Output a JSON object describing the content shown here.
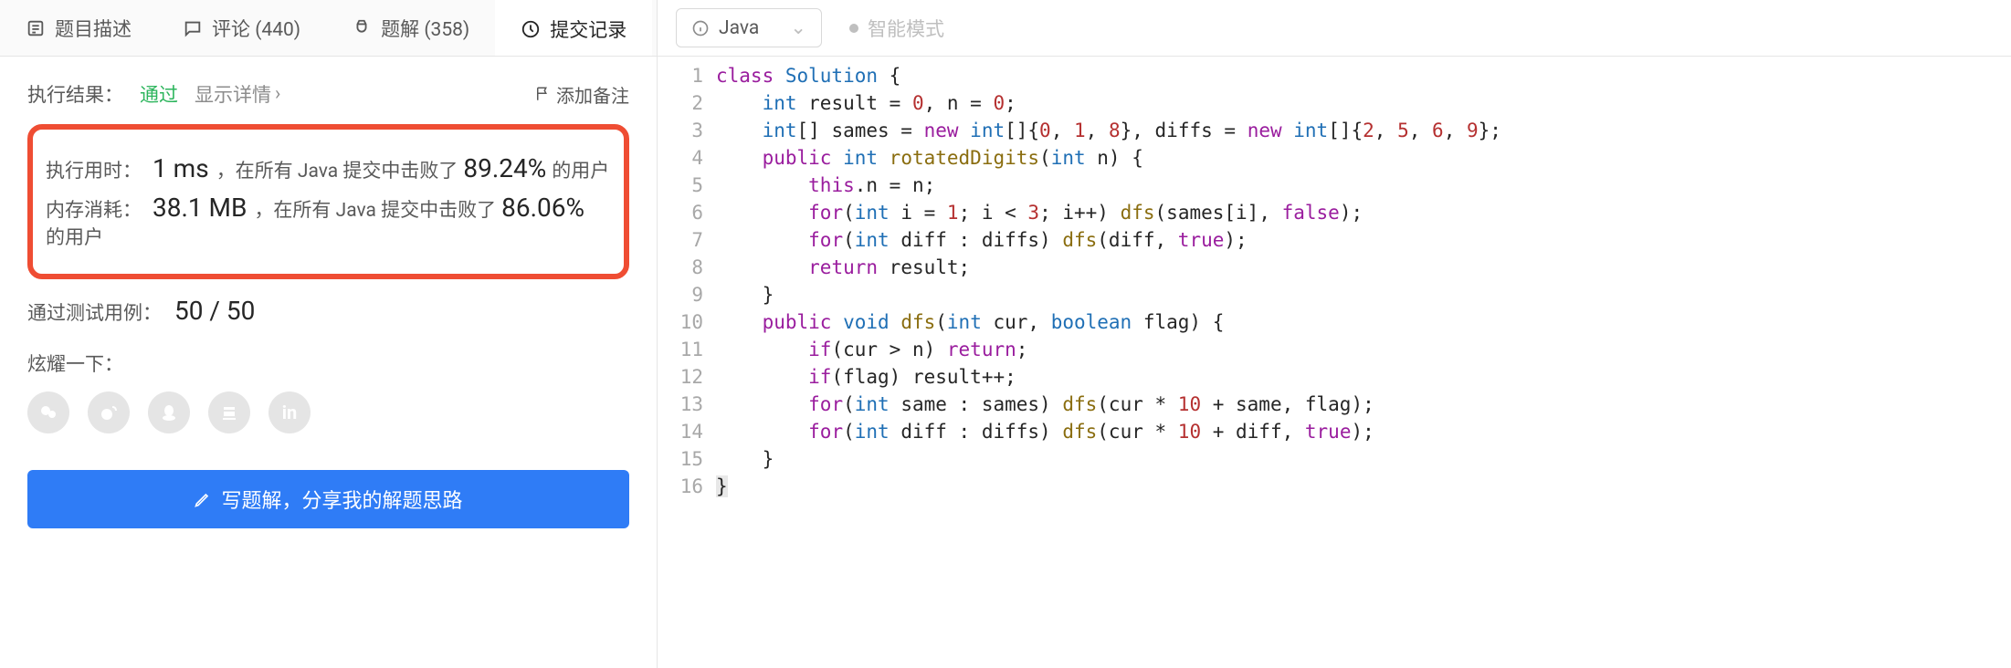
{
  "tabs": {
    "description": "题目描述",
    "comments": "评论 (440)",
    "solutions": "题解 (358)",
    "submissions": "提交记录"
  },
  "result": {
    "label": "执行结果：",
    "status": "通过",
    "details": "显示详情",
    "addNote": "添加备注",
    "runtime": {
      "label": "执行用时：",
      "value": "1 ms",
      "mid": "，在所有 Java 提交中击败了 ",
      "pct": "89.24%",
      "tail": " 的用户"
    },
    "memory": {
      "label": "内存消耗：",
      "value": "38.1 MB",
      "mid": "，在所有 Java 提交中击败了 ",
      "pct": "86.06%",
      "tail": " 的用户"
    },
    "cases": {
      "label": "通过测试用例：",
      "value": "50 / 50"
    },
    "shareLabel": "炫耀一下：",
    "shareButton": "写题解，分享我的解题思路"
  },
  "editor": {
    "language": "Java",
    "smartMode": "智能模式"
  },
  "code": {
    "lines": [
      {
        "n": 1,
        "tokens": [
          {
            "t": "class ",
            "c": "kw"
          },
          {
            "t": "Solution ",
            "c": "cls"
          },
          {
            "t": "{",
            "c": "p"
          }
        ]
      },
      {
        "n": 2,
        "tokens": [
          {
            "t": "    ",
            "c": "n"
          },
          {
            "t": "int ",
            "c": "type"
          },
          {
            "t": "result = ",
            "c": "n"
          },
          {
            "t": "0",
            "c": "num"
          },
          {
            "t": ", n = ",
            "c": "n"
          },
          {
            "t": "0",
            "c": "num"
          },
          {
            "t": ";",
            "c": "p"
          }
        ]
      },
      {
        "n": 3,
        "tokens": [
          {
            "t": "    ",
            "c": "n"
          },
          {
            "t": "int",
            "c": "type"
          },
          {
            "t": "[] sames = ",
            "c": "n"
          },
          {
            "t": "new ",
            "c": "kw"
          },
          {
            "t": "int",
            "c": "type"
          },
          {
            "t": "[]{",
            "c": "n"
          },
          {
            "t": "0",
            "c": "num"
          },
          {
            "t": ", ",
            "c": "n"
          },
          {
            "t": "1",
            "c": "num"
          },
          {
            "t": ", ",
            "c": "n"
          },
          {
            "t": "8",
            "c": "num"
          },
          {
            "t": "}, diffs = ",
            "c": "n"
          },
          {
            "t": "new ",
            "c": "kw"
          },
          {
            "t": "int",
            "c": "type"
          },
          {
            "t": "[]{",
            "c": "n"
          },
          {
            "t": "2",
            "c": "num"
          },
          {
            "t": ", ",
            "c": "n"
          },
          {
            "t": "5",
            "c": "num"
          },
          {
            "t": ", ",
            "c": "n"
          },
          {
            "t": "6",
            "c": "num"
          },
          {
            "t": ", ",
            "c": "n"
          },
          {
            "t": "9",
            "c": "num"
          },
          {
            "t": "};",
            "c": "p"
          }
        ]
      },
      {
        "n": 4,
        "tokens": [
          {
            "t": "    ",
            "c": "n"
          },
          {
            "t": "public ",
            "c": "kw"
          },
          {
            "t": "int ",
            "c": "type"
          },
          {
            "t": "rotatedDigits",
            "c": "fn"
          },
          {
            "t": "(",
            "c": "p"
          },
          {
            "t": "int ",
            "c": "type"
          },
          {
            "t": "n) {",
            "c": "n"
          }
        ]
      },
      {
        "n": 5,
        "tokens": [
          {
            "t": "        ",
            "c": "n"
          },
          {
            "t": "this",
            "c": "kw"
          },
          {
            "t": ".n = n;",
            "c": "n"
          }
        ]
      },
      {
        "n": 6,
        "tokens": [
          {
            "t": "        ",
            "c": "n"
          },
          {
            "t": "for",
            "c": "kw"
          },
          {
            "t": "(",
            "c": "p"
          },
          {
            "t": "int ",
            "c": "type"
          },
          {
            "t": "i = ",
            "c": "n"
          },
          {
            "t": "1",
            "c": "num"
          },
          {
            "t": "; i < ",
            "c": "n"
          },
          {
            "t": "3",
            "c": "num"
          },
          {
            "t": "; i++) ",
            "c": "n"
          },
          {
            "t": "dfs",
            "c": "fn"
          },
          {
            "t": "(sames[i], ",
            "c": "n"
          },
          {
            "t": "false",
            "c": "bool"
          },
          {
            "t": ");",
            "c": "p"
          }
        ]
      },
      {
        "n": 7,
        "tokens": [
          {
            "t": "        ",
            "c": "n"
          },
          {
            "t": "for",
            "c": "kw"
          },
          {
            "t": "(",
            "c": "p"
          },
          {
            "t": "int ",
            "c": "type"
          },
          {
            "t": "diff : diffs) ",
            "c": "n"
          },
          {
            "t": "dfs",
            "c": "fn"
          },
          {
            "t": "(diff, ",
            "c": "n"
          },
          {
            "t": "true",
            "c": "bool"
          },
          {
            "t": ");",
            "c": "p"
          }
        ]
      },
      {
        "n": 8,
        "tokens": [
          {
            "t": "        ",
            "c": "n"
          },
          {
            "t": "return ",
            "c": "kw"
          },
          {
            "t": "result;",
            "c": "n"
          }
        ]
      },
      {
        "n": 9,
        "tokens": [
          {
            "t": "    }",
            "c": "n"
          }
        ]
      },
      {
        "n": 10,
        "tokens": [
          {
            "t": "    ",
            "c": "n"
          },
          {
            "t": "public ",
            "c": "kw"
          },
          {
            "t": "void ",
            "c": "type"
          },
          {
            "t": "dfs",
            "c": "fn"
          },
          {
            "t": "(",
            "c": "p"
          },
          {
            "t": "int ",
            "c": "type"
          },
          {
            "t": "cur, ",
            "c": "n"
          },
          {
            "t": "boolean ",
            "c": "type"
          },
          {
            "t": "flag) {",
            "c": "n"
          }
        ]
      },
      {
        "n": 11,
        "tokens": [
          {
            "t": "        ",
            "c": "n"
          },
          {
            "t": "if",
            "c": "kw"
          },
          {
            "t": "(cur > n) ",
            "c": "n"
          },
          {
            "t": "return",
            "c": "kw"
          },
          {
            "t": ";",
            "c": "p"
          }
        ]
      },
      {
        "n": 12,
        "tokens": [
          {
            "t": "        ",
            "c": "n"
          },
          {
            "t": "if",
            "c": "kw"
          },
          {
            "t": "(flag) result++;",
            "c": "n"
          }
        ]
      },
      {
        "n": 13,
        "tokens": [
          {
            "t": "        ",
            "c": "n"
          },
          {
            "t": "for",
            "c": "kw"
          },
          {
            "t": "(",
            "c": "p"
          },
          {
            "t": "int ",
            "c": "type"
          },
          {
            "t": "same : sames) ",
            "c": "n"
          },
          {
            "t": "dfs",
            "c": "fn"
          },
          {
            "t": "(cur * ",
            "c": "n"
          },
          {
            "t": "10",
            "c": "num"
          },
          {
            "t": " + same, flag);",
            "c": "n"
          }
        ]
      },
      {
        "n": 14,
        "tokens": [
          {
            "t": "        ",
            "c": "n"
          },
          {
            "t": "for",
            "c": "kw"
          },
          {
            "t": "(",
            "c": "p"
          },
          {
            "t": "int ",
            "c": "type"
          },
          {
            "t": "diff : diffs) ",
            "c": "n"
          },
          {
            "t": "dfs",
            "c": "fn"
          },
          {
            "t": "(cur * ",
            "c": "n"
          },
          {
            "t": "10",
            "c": "num"
          },
          {
            "t": " + diff, ",
            "c": "n"
          },
          {
            "t": "true",
            "c": "bool"
          },
          {
            "t": ");",
            "c": "p"
          }
        ]
      },
      {
        "n": 15,
        "tokens": [
          {
            "t": "    }",
            "c": "n"
          }
        ]
      },
      {
        "n": 16,
        "tokens": [
          {
            "t": "}",
            "c": "n"
          }
        ],
        "active": true
      }
    ]
  },
  "icons": {
    "shareWechat": "wechat-icon",
    "shareWeibo": "weibo-icon",
    "shareQQ": "qq-icon",
    "shareDouban": "douban-icon",
    "shareLinkedin": "linkedin-icon"
  }
}
